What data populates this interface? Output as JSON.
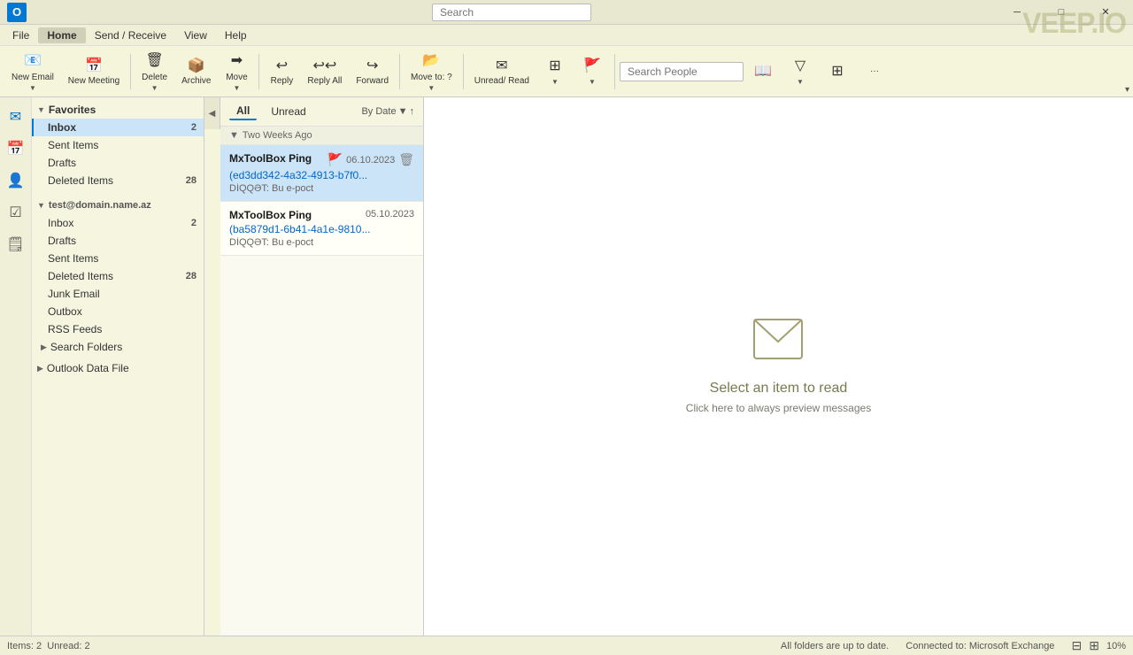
{
  "titlebar": {
    "search_placeholder": "Search",
    "controls": [
      "─",
      "□",
      "✕"
    ]
  },
  "menubar": {
    "items": [
      "File",
      "Home",
      "Send / Receive",
      "View",
      "Help"
    ],
    "active": "Home"
  },
  "ribbon": {
    "new_email_label": "New Email",
    "new_meeting_label": "New Meeting",
    "delete_label": "Delete",
    "archive_label": "Archive",
    "move_label": "Move",
    "reply_label": "Reply",
    "reply_all_label": "Reply All",
    "forward_label": "Forward",
    "move_to_label": "Move to: ?",
    "unread_read_label": "Unread/ Read",
    "search_people_placeholder": "Search People",
    "more_label": "···"
  },
  "favorites": {
    "label": "Favorites",
    "items": [
      {
        "name": "Inbox",
        "badge": "2",
        "active": true
      },
      {
        "name": "Sent Items",
        "badge": ""
      },
      {
        "name": "Drafts",
        "badge": ""
      },
      {
        "name": "Deleted Items",
        "badge": "28"
      }
    ]
  },
  "account": {
    "email": "test@domain.name.az",
    "folders": [
      {
        "name": "Inbox",
        "badge": "2"
      },
      {
        "name": "Drafts",
        "badge": ""
      },
      {
        "name": "Sent Items",
        "badge": ""
      },
      {
        "name": "Deleted Items",
        "badge": "28"
      },
      {
        "name": "Junk Email",
        "badge": ""
      },
      {
        "name": "Outbox",
        "badge": ""
      },
      {
        "name": "RSS Feeds",
        "badge": ""
      }
    ],
    "search_folders": "Search Folders",
    "outlook_data_file": "Outlook Data File"
  },
  "message_list": {
    "tabs": [
      "All",
      "Unread"
    ],
    "active_tab": "All",
    "sort_label": "By Date",
    "date_group": "Two Weeks Ago",
    "messages": [
      {
        "sender": "MxToolBox Ping",
        "email_id": "(ed3dd342-4a32-4913-b7f0...",
        "date": "06.10.2023",
        "preview": "DİQQƏT: Bu e-poct",
        "flagged": true,
        "selected": true
      },
      {
        "sender": "MxToolBox Ping",
        "email_id": "(ba5879d1-6b41-4a1e-9810...",
        "date": "05.10.2023",
        "preview": "DİQQƏT: Bu e-poct",
        "flagged": false,
        "selected": false
      }
    ]
  },
  "reading_pane": {
    "empty_title": "Select an item to read",
    "empty_subtitle": "Click here to always preview messages"
  },
  "statusbar": {
    "items_label": "Items: 2",
    "unread_label": "Unread: 2",
    "connection": "All folders are up to date.",
    "exchange": "Connected to: Microsoft Exchange",
    "zoom": "10%"
  },
  "watermark": "VEEP.IO"
}
